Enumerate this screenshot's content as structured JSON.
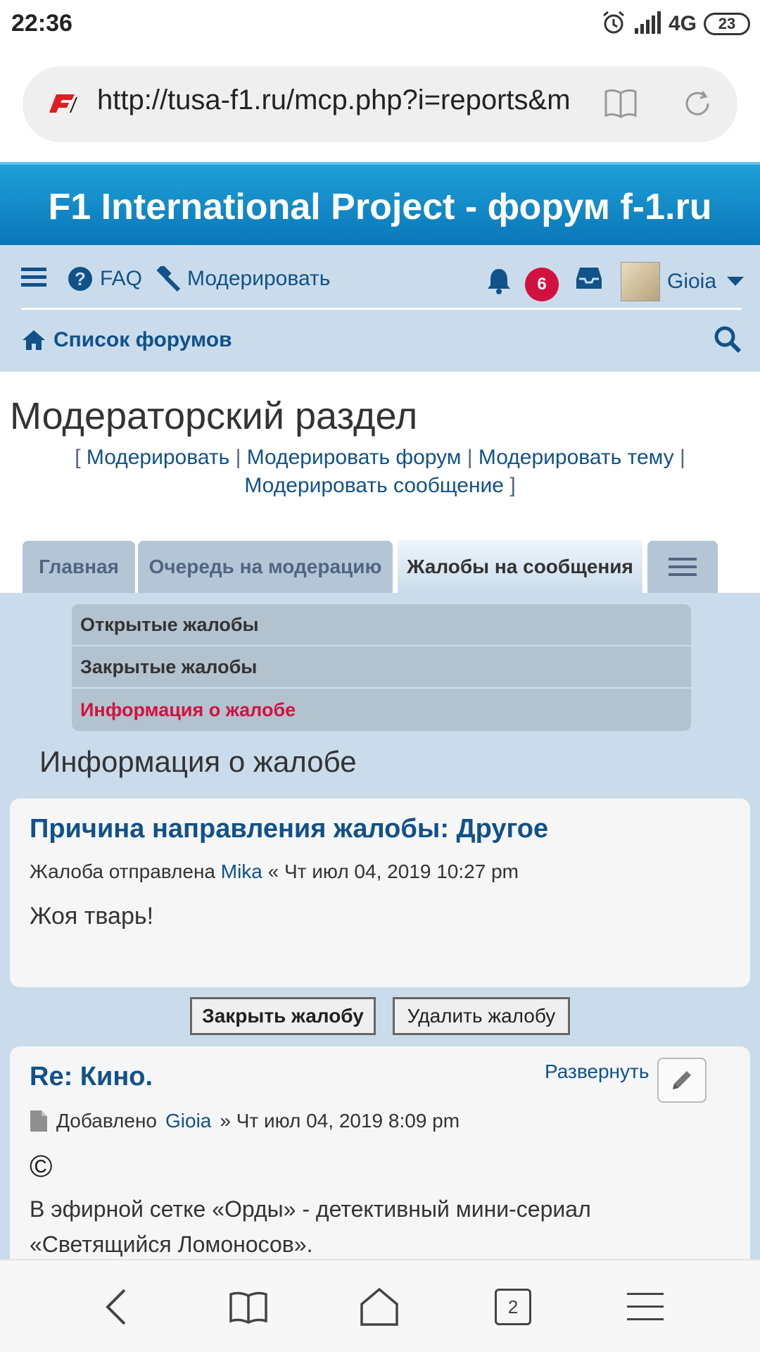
{
  "status": {
    "time": "22:36",
    "network": "4G",
    "battery": "23"
  },
  "browser": {
    "url": "http://tusa-f1.ru/mcp.php?i=reports&m",
    "tabs_count": "2"
  },
  "site": {
    "title": "F1 International Project - форум f-1.ru"
  },
  "nav": {
    "faq": "FAQ",
    "moderate": "Модерировать",
    "notifications_count": "6",
    "username": "Gioia",
    "forums_list": "Список форумов"
  },
  "page": {
    "title": "Модераторский раздел",
    "links": {
      "open": "[",
      "moderate": "Модерировать",
      "sep": "|",
      "moderate_forum": "Модерировать форум",
      "moderate_topic": "Модерировать тему",
      "moderate_post": "Модерировать сообщение",
      "close": "]"
    }
  },
  "tabs": [
    {
      "label": "Главная"
    },
    {
      "label": "Очередь на модерацию"
    },
    {
      "label": "Жалобы на сообщения"
    }
  ],
  "submenu": [
    {
      "label": "Открытые жалобы"
    },
    {
      "label": "Закрытые жалобы"
    },
    {
      "label": "Информация о жалобе"
    }
  ],
  "section_title": "Информация о жалобе",
  "report": {
    "heading": "Причина направления жалобы: Другое",
    "meta_prefix": "Жалоба отправлена",
    "user": "Mika",
    "meta_suffix": "« Чт июл 04, 2019 10:27 pm",
    "body": "Жоя тварь!"
  },
  "actions": {
    "close_report": "Закрыть жалобу",
    "delete_report": "Удалить жалобу"
  },
  "post": {
    "title": "Re: Кино.",
    "expand": "Развернуть",
    "meta_prefix": "Добавлено",
    "user": "Gioia",
    "meta_suffix": "» Чт июл 04, 2019 8:09 pm",
    "copyright_sign": "©",
    "text": "В эфирной сетке «Орды» - детективный мини-сериал «Светящийся Ломоносов»."
  },
  "colors": {
    "brand_blue": "#0a76b8",
    "link_blue": "#105289",
    "nav_bg": "#cadceb",
    "active_red": "#d31141"
  }
}
